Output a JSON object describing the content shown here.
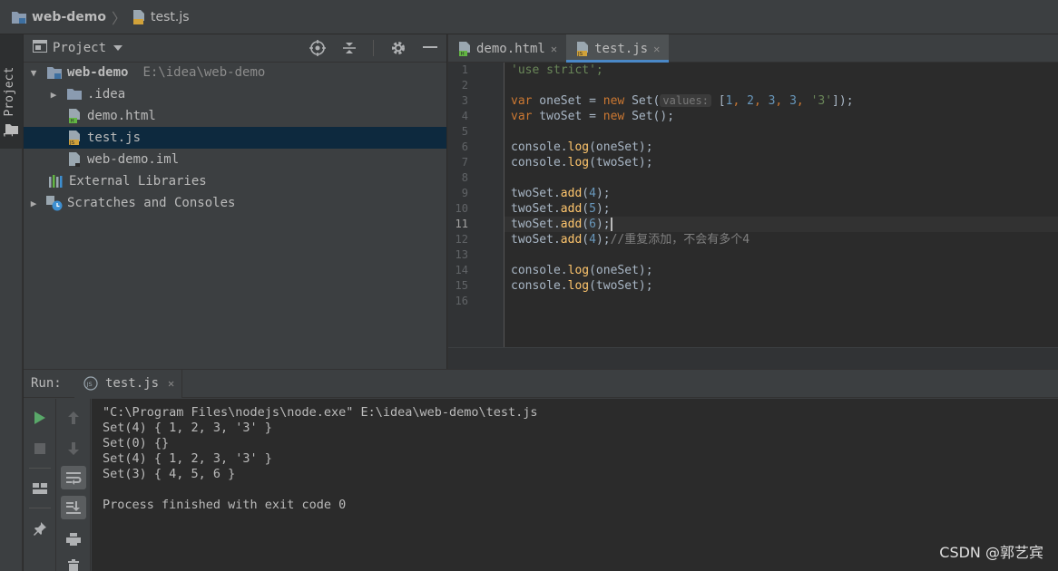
{
  "breadcrumb": {
    "project": "web-demo",
    "file": "test.js"
  },
  "left_stripe": {
    "project_label": "1: Project"
  },
  "project_panel": {
    "title": "Project",
    "tree": [
      {
        "label": "web-demo",
        "path": "E:\\idea\\web-demo",
        "icon": "project-folder-icon",
        "expanded": true
      },
      {
        "label": ".idea",
        "icon": "folder-icon",
        "expanded": false
      },
      {
        "label": "demo.html",
        "icon": "html-file-icon"
      },
      {
        "label": "test.js",
        "icon": "js-file-icon",
        "selected": true
      },
      {
        "label": "web-demo.iml",
        "icon": "iml-file-icon"
      },
      {
        "label": "External Libraries",
        "icon": "libraries-icon"
      },
      {
        "label": "Scratches and Consoles",
        "icon": "scratches-icon",
        "expanded": false
      }
    ]
  },
  "editor": {
    "tabs": [
      {
        "label": "demo.html",
        "active": false
      },
      {
        "label": "test.js",
        "active": true
      }
    ],
    "line_numbers": [
      "1",
      "2",
      "3",
      "4",
      "5",
      "6",
      "7",
      "8",
      "9",
      "10",
      "11",
      "12",
      "13",
      "14",
      "15",
      "16"
    ],
    "current_line": "11",
    "code": {
      "l1": "'use strict';",
      "l3": {
        "kw1": "var",
        "name": " oneSet = ",
        "kw2": "new",
        "call": " Set(",
        "hint": "values:",
        "arr_open": " [",
        "n1": "1",
        "c1": ", ",
        "n2": "2",
        "c2": ", ",
        "n3": "3",
        "c3": ", ",
        "n4": "3",
        "c4": ", ",
        "str": "'3'",
        "close": "]);"
      },
      "l4": {
        "kw1": "var",
        "name": " twoSet = ",
        "kw2": "new",
        "call": " Set();"
      },
      "l6": {
        "obj": "console.",
        "fn": "log",
        "arg": "(oneSet);"
      },
      "l7": {
        "obj": "console.",
        "fn": "log",
        "arg": "(twoSet);"
      },
      "l9": {
        "obj": "twoSet.",
        "fn": "add",
        "open": "(",
        "num": "4",
        "close": ");"
      },
      "l10": {
        "obj": "twoSet.",
        "fn": "add",
        "open": "(",
        "num": "5",
        "close": ");"
      },
      "l11": {
        "obj": "twoSet.",
        "fn": "add",
        "open": "(",
        "num": "6",
        "close": ");"
      },
      "l12": {
        "obj": "twoSet.",
        "fn": "add",
        "open": "(",
        "num": "4",
        "close": ");",
        "comment": "//重复添加，不会有多个4"
      },
      "l14": {
        "obj": "console.",
        "fn": "log",
        "arg": "(oneSet);"
      },
      "l15": {
        "obj": "console.",
        "fn": "log",
        "arg": "(twoSet);"
      }
    }
  },
  "run_panel": {
    "label": "Run:",
    "tab": "test.js",
    "output": [
      "\"C:\\Program Files\\nodejs\\node.exe\" E:\\idea\\web-demo\\test.js",
      "Set(4) { 1, 2, 3, '3' }",
      "Set(0) {}",
      "Set(4) { 1, 2, 3, '3' }",
      "Set(3) { 4, 5, 6 }",
      "",
      "Process finished with exit code 0"
    ]
  },
  "watermark": "CSDN @郭艺宾",
  "colors": {
    "accent": "#4a88c7",
    "keyword": "#cc7832",
    "string": "#6a8759",
    "number": "#6897bb",
    "function": "#ffc66d",
    "background": "#2b2b2b",
    "panel": "#3c3f41",
    "selection": "#0d293e"
  }
}
